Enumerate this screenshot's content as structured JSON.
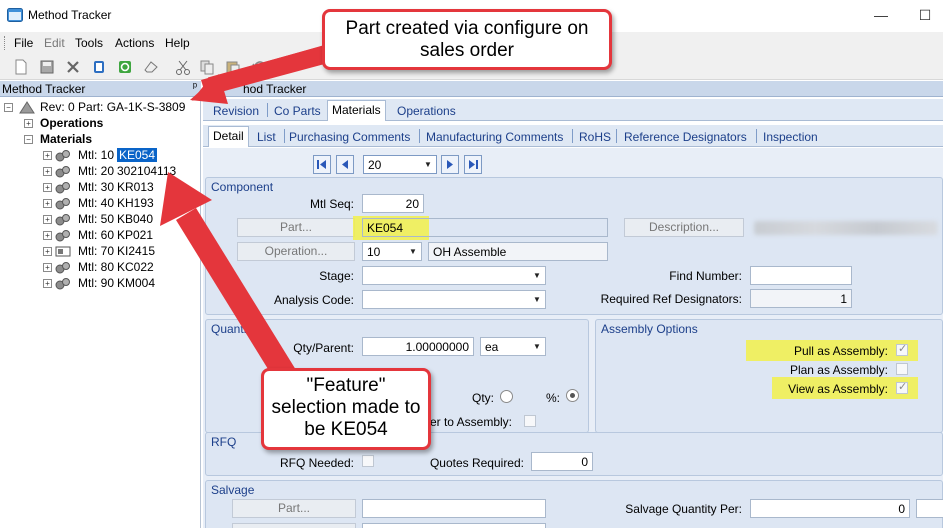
{
  "window": {
    "title": "Method Tracker",
    "minimize_glyph": "—",
    "maximize_glyph": "☐"
  },
  "menu": [
    "File",
    "Edit",
    "Tools",
    "Actions",
    "Help"
  ],
  "toolbar_icons": [
    "new-icon",
    "save-icon",
    "delete-icon",
    "attach-icon",
    "refresh-icon",
    "clear-icon",
    "cut-icon",
    "copy-icon",
    "paste-icon",
    "undo-icon"
  ],
  "left_panel": {
    "title": "Method Tracker",
    "pin_glyph": "ᵖ",
    "tree": {
      "root": "Rev: 0 Part: GA-1K-S-3809",
      "operations": "Operations",
      "materials": "Materials",
      "items": [
        {
          "prefix": "Mtl: 10",
          "part": "KE054",
          "selected": true
        },
        {
          "prefix": "Mtl: 20",
          "part": "302104113",
          "selected": false
        },
        {
          "prefix": "Mtl: 30",
          "part": "KR013",
          "selected": false
        },
        {
          "prefix": "Mtl: 40",
          "part": "KH193",
          "selected": false
        },
        {
          "prefix": "Mtl: 50",
          "part": "KB040",
          "selected": false
        },
        {
          "prefix": "Mtl: 60",
          "part": "KP021",
          "selected": false
        },
        {
          "prefix": "Mtl: 70",
          "part": "KI2415",
          "selected": false
        },
        {
          "prefix": "Mtl: 80",
          "part": "KC022",
          "selected": false
        },
        {
          "prefix": "Mtl: 90",
          "part": "KM004",
          "selected": false
        }
      ]
    }
  },
  "right_panel": {
    "title": "hod Tracker",
    "tabs_top": [
      "Revision",
      "Co Parts",
      "Materials",
      "Operations"
    ],
    "tabs_sub": [
      "Detail",
      "List",
      "Purchasing Comments",
      "Manufacturing Comments",
      "RoHS",
      "Reference Designators",
      "Inspection"
    ],
    "navigator_value": "20",
    "component": {
      "title": "Component",
      "mtl_seq_label": "Mtl Seq:",
      "mtl_seq": "20",
      "part_button": "Part...",
      "part_value": "KE054",
      "description_button": "Description...",
      "operation_button": "Operation...",
      "operation_value": "10",
      "operation_desc": "OH Assemble",
      "stage_label": "Stage:",
      "analysis_code_label": "Analysis Code:",
      "find_number_label": "Find Number:",
      "required_ref_label": "Required Ref Designators:",
      "required_ref_value": "1"
    },
    "quantities": {
      "title": "Quantities",
      "qty_parent_label": "Qty/Parent:",
      "qty_parent": "1.00000000",
      "uom": "ea",
      "qty_label": "Qty:",
      "pct_label": "%:",
      "fixed_label": "er to Assembly:"
    },
    "assembly_options": {
      "title": "Assembly Options",
      "pull_label": "Pull as Assembly:",
      "plan_label": "Plan as Assembly:",
      "view_label": "View as Assembly:",
      "pull_checked": true,
      "plan_checked": false,
      "view_checked": true
    },
    "rfq": {
      "title": "RFQ",
      "rfq_needed_label": "RFQ Needed:",
      "quotes_required_label": "Quotes Required:",
      "quotes_required": "0"
    },
    "salvage": {
      "title": "Salvage",
      "part_button": "Part...",
      "qty_per_label": "Salvage Quantity Per:",
      "qty_per": "0"
    }
  },
  "callouts": {
    "top": "Part created via configure on sales order",
    "middle_l1": "\"Feature\"",
    "middle_l2": "selection made to",
    "middle_l3": "be KE054"
  },
  "colors": {
    "callout_border": "#e4363c",
    "highlight": "#f2f04a",
    "selection": "#0a64c8"
  }
}
